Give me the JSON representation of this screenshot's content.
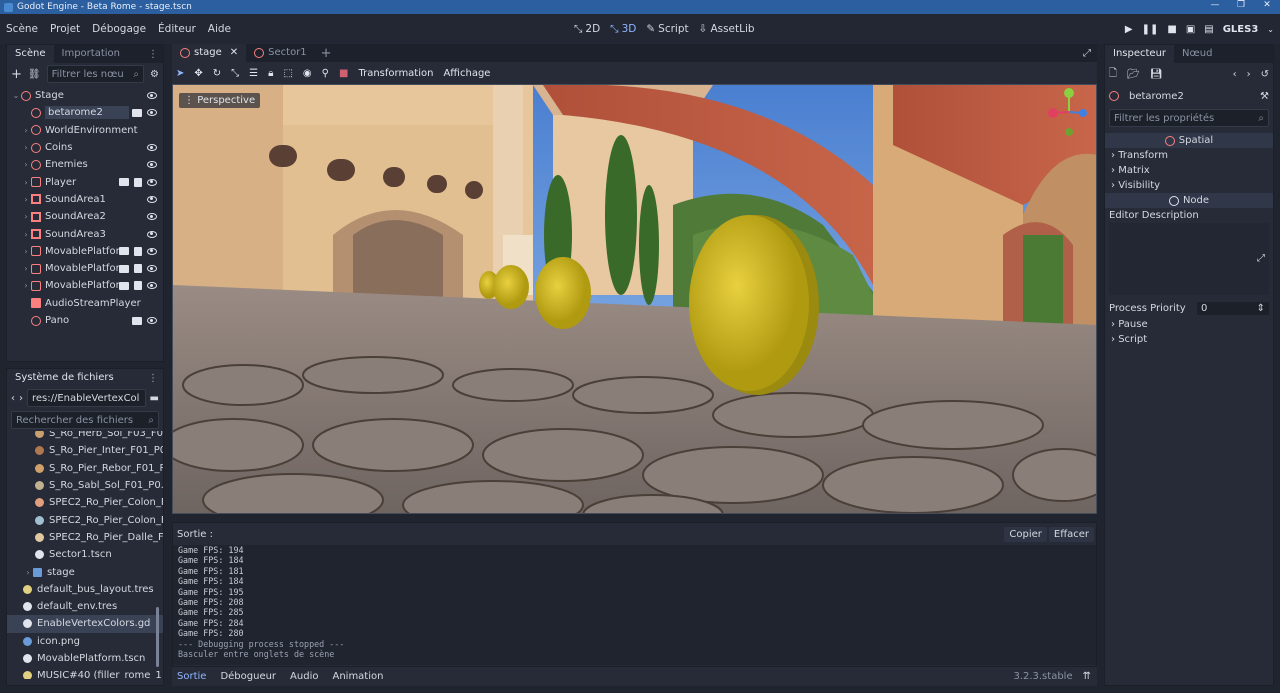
{
  "window": {
    "title": "Godot Engine - Beta Rome - stage.tscn"
  },
  "menu": [
    "Scène",
    "Projet",
    "Débogage",
    "Éditeur",
    "Aide"
  ],
  "modes": [
    {
      "label": "2D",
      "active": false
    },
    {
      "label": "3D",
      "active": true
    },
    {
      "label": "Script",
      "active": false
    },
    {
      "label": "AssetLib",
      "active": false
    }
  ],
  "renderer": "GLES3",
  "scene_dock": {
    "tabs": [
      "Scène",
      "Importation"
    ],
    "filter_placeholder": "Filtrer les nœu",
    "nodes": [
      {
        "name": "Stage",
        "icon": "spatial-icon",
        "depth": 0,
        "arrow": "⌄"
      },
      {
        "name": "betarome2",
        "icon": "spatial-icon",
        "depth": 1,
        "selected": true
      },
      {
        "name": "WorldEnvironment",
        "icon": "world-environment-icon",
        "depth": 1,
        "arrow": "›"
      },
      {
        "name": "Coins",
        "icon": "spatial-icon",
        "depth": 1,
        "arrow": "›"
      },
      {
        "name": "Enemies",
        "icon": "spatial-icon",
        "depth": 1,
        "arrow": "›"
      },
      {
        "name": "Player",
        "icon": "kinematic-body-icon",
        "depth": 1,
        "arrow": "›"
      },
      {
        "name": "SoundArea1",
        "icon": "area-icon",
        "depth": 1,
        "arrow": "›"
      },
      {
        "name": "SoundArea2",
        "icon": "area-icon",
        "depth": 1,
        "arrow": "›"
      },
      {
        "name": "SoundArea3",
        "icon": "area-icon",
        "depth": 1,
        "arrow": "›"
      },
      {
        "name": "MovablePlatfor",
        "icon": "kinematic-body-icon",
        "depth": 1,
        "arrow": "›"
      },
      {
        "name": "MovablePlatfor",
        "icon": "kinematic-body-icon",
        "depth": 1,
        "arrow": "›"
      },
      {
        "name": "MovablePlatfor",
        "icon": "kinematic-body-icon",
        "depth": 1,
        "arrow": "›"
      },
      {
        "name": "AudioStreamPlayer",
        "icon": "audio-icon",
        "depth": 1
      },
      {
        "name": "Pano",
        "icon": "spatial-icon",
        "depth": 1
      }
    ]
  },
  "filesystem": {
    "title": "Système de fichiers",
    "path": "res://EnableVertexCol",
    "search_placeholder": "Rechercher des fichiers",
    "files": [
      {
        "name": "S_Ro_Herb_Sol_F03_F0.",
        "color": "#c8a070"
      },
      {
        "name": "S_Ro_Pier_Inter_F01_P0",
        "color": "#b07850"
      },
      {
        "name": "S_Ro_Pier_Rebor_F01_P",
        "color": "#d0a068"
      },
      {
        "name": "S_Ro_Sabl_Sol_F01_P0.",
        "color": "#c0b090"
      },
      {
        "name": "SPEC2_Ro_Pier_Colon_F",
        "color": "#e0a080"
      },
      {
        "name": "SPEC2_Ro_Pier_Colon_F",
        "color": "#a0c0d0"
      },
      {
        "name": "SPEC2_Ro_Pier_Dalle_F",
        "color": "#e0c8a0"
      },
      {
        "name": "Sector1.tscn",
        "color": "#e0e4ec"
      },
      {
        "name": "stage",
        "color": "#6a9ad8"
      },
      {
        "name": "default_bus_layout.tres",
        "color": "#e0d080"
      },
      {
        "name": "default_env.tres",
        "color": "#e0e4ec"
      },
      {
        "name": "EnableVertexColors.gd",
        "color": "#e0e4ec"
      },
      {
        "name": "icon.png",
        "color": "#6a9ad8"
      },
      {
        "name": "MovablePlatform.tscn",
        "color": "#e0e4ec"
      },
      {
        "name": "MUSIC#40 (filler_rome_1",
        "color": "#e0d080"
      }
    ]
  },
  "editor_tabs": [
    "stage",
    "Sector1"
  ],
  "viewport_menu": [
    "Transformation",
    "Affichage"
  ],
  "viewport_label": "Perspective",
  "output": {
    "title": "Sortie :",
    "copy": "Copier",
    "clear": "Effacer",
    "lines": [
      "Game FPS: 194",
      "Game FPS: 184",
      "Game FPS: 181",
      "Game FPS: 184",
      "Game FPS: 195",
      "Game FPS: 208",
      "Game FPS: 285",
      "Game FPS: 284",
      "Game FPS: 280",
      "--- Debugging process stopped ---",
      "Basculer entre onglets de scène"
    ]
  },
  "bottom_tabs": [
    "Sortie",
    "Débogueur",
    "Audio",
    "Animation"
  ],
  "version": "3.2.3.stable",
  "inspector": {
    "tabs": [
      "Inspecteur",
      "Nœud"
    ],
    "object": "betarome2",
    "filter_placeholder": "Filtrer les propriétés",
    "spatial_header": "Spatial",
    "spatial_sections": [
      "Transform",
      "Matrix",
      "Visibility"
    ],
    "node_header": "Node",
    "editor_description": "Editor Description",
    "process_priority_label": "Process Priority",
    "process_priority_value": "0",
    "node_sections": [
      "Pause",
      "Script"
    ]
  }
}
